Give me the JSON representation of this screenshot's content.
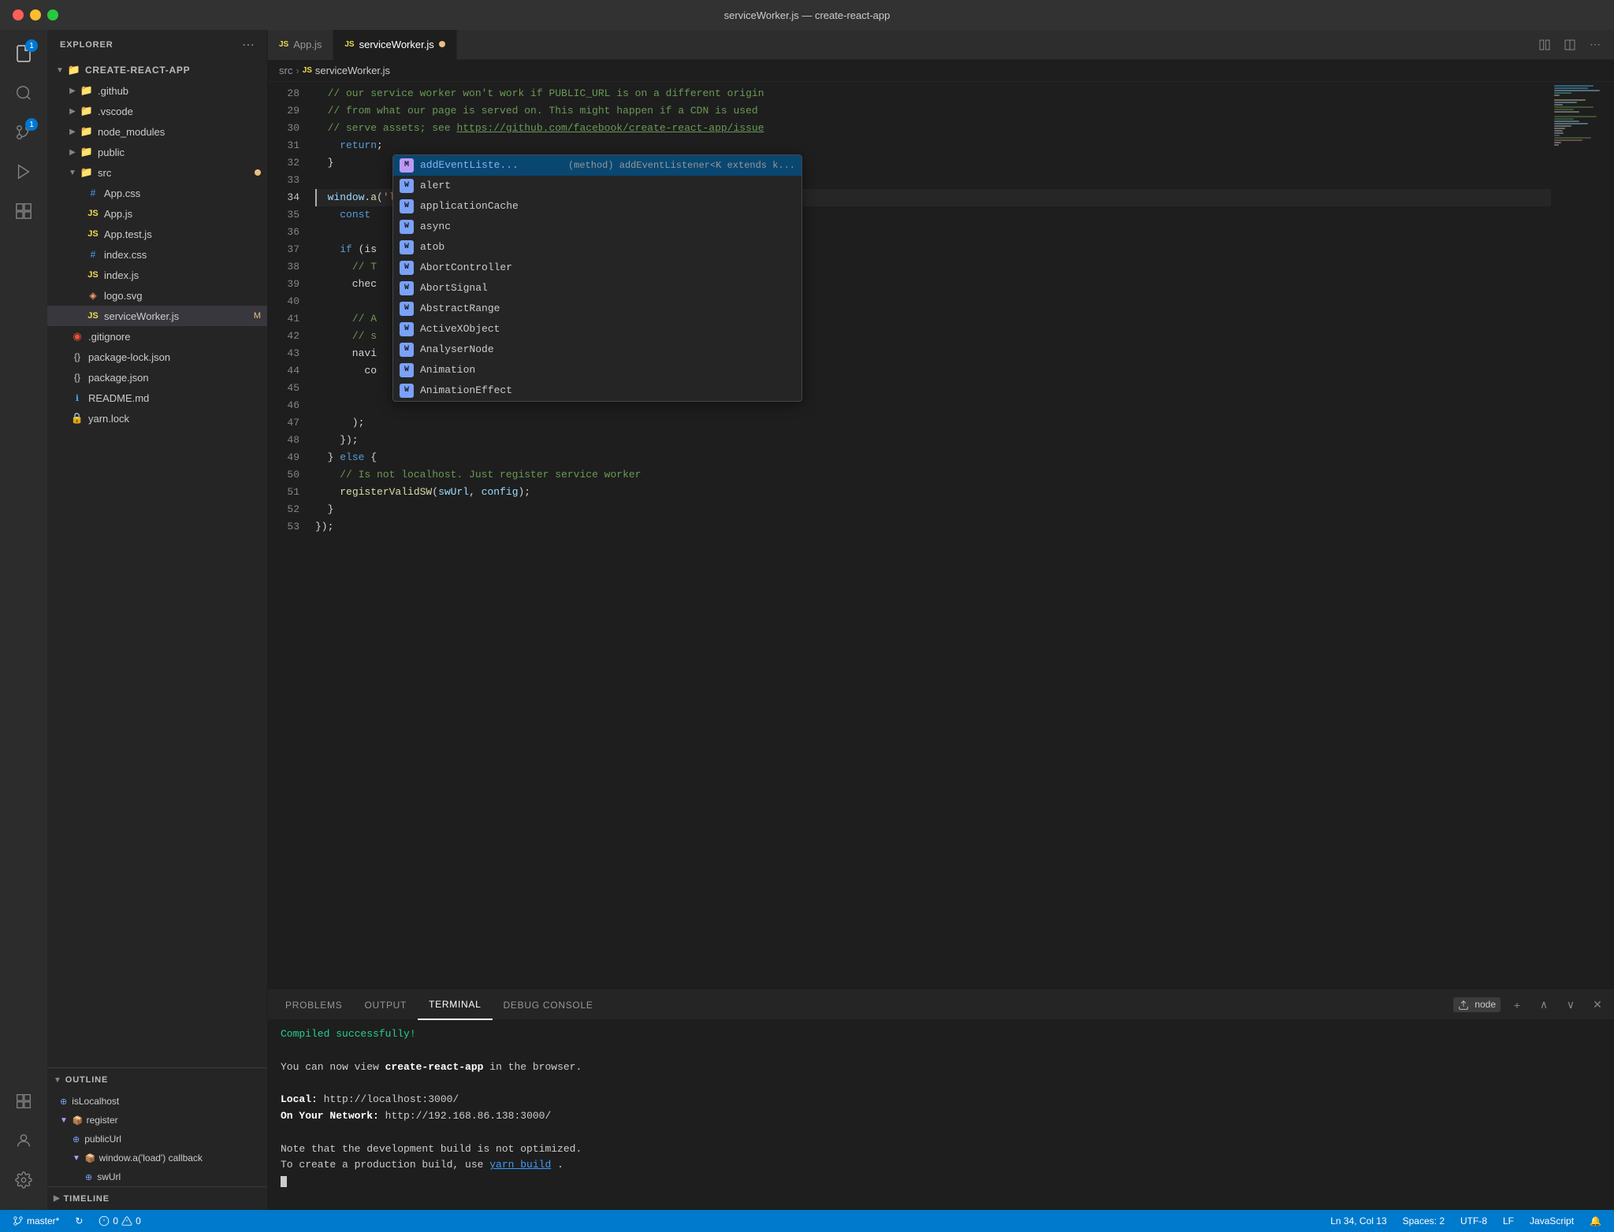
{
  "titlebar": {
    "title": "serviceWorker.js — create-react-app"
  },
  "activity_bar": {
    "icons": [
      {
        "name": "files-icon",
        "symbol": "⊞",
        "badge": "1",
        "active": false
      },
      {
        "name": "search-icon",
        "symbol": "🔍",
        "active": false
      },
      {
        "name": "source-control-icon",
        "symbol": "⑂",
        "badge": "1",
        "active": false
      },
      {
        "name": "run-debug-icon",
        "symbol": "▷",
        "active": false
      },
      {
        "name": "extensions-icon",
        "symbol": "⊡",
        "active": false
      }
    ],
    "bottom_icons": [
      {
        "name": "remote-icon",
        "symbol": "⊞",
        "active": false
      },
      {
        "name": "account-icon",
        "symbol": "👤",
        "active": false
      },
      {
        "name": "settings-icon",
        "symbol": "⚙",
        "active": false
      }
    ]
  },
  "sidebar": {
    "title": "EXPLORER",
    "project": "CREATE-REACT-APP",
    "tree": [
      {
        "id": "github",
        "label": ".github",
        "type": "folder",
        "depth": 1,
        "expanded": false
      },
      {
        "id": "vscode",
        "label": ".vscode",
        "type": "folder",
        "depth": 1,
        "expanded": false
      },
      {
        "id": "node_modules",
        "label": "node_modules",
        "type": "folder",
        "depth": 1,
        "expanded": false
      },
      {
        "id": "public",
        "label": "public",
        "type": "folder",
        "depth": 1,
        "expanded": false
      },
      {
        "id": "src",
        "label": "src",
        "type": "folder",
        "depth": 1,
        "expanded": true
      },
      {
        "id": "app_css",
        "label": "App.css",
        "type": "css",
        "depth": 2
      },
      {
        "id": "app_js",
        "label": "App.js",
        "type": "js",
        "depth": 2
      },
      {
        "id": "app_test_js",
        "label": "App.test.js",
        "type": "js",
        "depth": 2
      },
      {
        "id": "index_css",
        "label": "index.css",
        "type": "css",
        "depth": 2
      },
      {
        "id": "index_js",
        "label": "index.js",
        "type": "js",
        "depth": 2
      },
      {
        "id": "logo_svg",
        "label": "logo.svg",
        "type": "svg",
        "depth": 2
      },
      {
        "id": "serviceworker_js",
        "label": "serviceWorker.js",
        "type": "js",
        "depth": 2,
        "modified": true,
        "selected": true
      },
      {
        "id": "gitignore",
        "label": ".gitignore",
        "type": "git",
        "depth": 1
      },
      {
        "id": "package_lock",
        "label": "package-lock.json",
        "type": "json",
        "depth": 1
      },
      {
        "id": "package_json",
        "label": "package.json",
        "type": "json",
        "depth": 1
      },
      {
        "id": "readme",
        "label": "README.md",
        "type": "md",
        "depth": 1
      },
      {
        "id": "yarn_lock",
        "label": "yarn.lock",
        "type": "lock",
        "depth": 1
      }
    ]
  },
  "outline": {
    "title": "OUTLINE",
    "items": [
      {
        "label": "isLocalhost",
        "icon": "⊕",
        "depth": 0
      },
      {
        "label": "register",
        "icon": "📦",
        "depth": 0,
        "expanded": true
      },
      {
        "label": "publicUrl",
        "icon": "⊕",
        "depth": 1
      },
      {
        "label": "window.a('load') callback",
        "icon": "📦",
        "depth": 1,
        "expanded": true
      },
      {
        "label": "swUrl",
        "icon": "⊕",
        "depth": 2
      }
    ]
  },
  "timeline": {
    "title": "TIMELINE"
  },
  "tabs": [
    {
      "id": "app_js_tab",
      "label": "App.js",
      "type": "js",
      "active": false
    },
    {
      "id": "serviceworker_tab",
      "label": "serviceWorker.js",
      "type": "js",
      "active": true,
      "modified": true
    }
  ],
  "breadcrumb": {
    "parts": [
      "src",
      "JS",
      "serviceWorker.js"
    ]
  },
  "editor": {
    "lines": [
      {
        "num": 28,
        "code": "  // our service worker won't work if PUBLIC_URL is on a different origin"
      },
      {
        "num": 29,
        "code": "  // from what our page is served on. This might happen if a CDN is used"
      },
      {
        "num": 30,
        "code": "  // serve assets; see https://github.com/facebook/create-react-app/issue"
      },
      {
        "num": 31,
        "code": "    return;"
      },
      {
        "num": 32,
        "code": "  }"
      },
      {
        "num": 33,
        "code": ""
      },
      {
        "num": 34,
        "code": "  window.a('load', () => {",
        "active": true
      },
      {
        "num": 35,
        "code": "    const "
      },
      {
        "num": 36,
        "code": ""
      },
      {
        "num": 37,
        "code": "    if (is                                           stil"
      },
      {
        "num": 38,
        "code": "      // T"
      },
      {
        "num": 39,
        "code": "      chec"
      },
      {
        "num": 40,
        "code": ""
      },
      {
        "num": 41,
        "code": "      // A                                              to t"
      },
      {
        "num": 42,
        "code": "      // s"
      },
      {
        "num": 43,
        "code": "      navi"
      },
      {
        "num": 44,
        "code": "        co"
      },
      {
        "num": 45,
        "code": ""
      },
      {
        "num": 46,
        "code": ""
      },
      {
        "num": 47,
        "code": "      );"
      },
      {
        "num": 48,
        "code": "    });"
      },
      {
        "num": 49,
        "code": "  } else {"
      },
      {
        "num": 50,
        "code": "    // Is not localhost. Just register service worker"
      },
      {
        "num": 51,
        "code": "    registerValidSW(swUrl, config);"
      },
      {
        "num": 52,
        "code": "  }"
      },
      {
        "num": 53,
        "code": "});"
      }
    ],
    "cursor": {
      "line": 34,
      "col": 13
    }
  },
  "autocomplete": {
    "items": [
      {
        "label": "addEventListener",
        "detail": "(method) addEventListener<K extends k...",
        "icon_type": "method",
        "icon_letter": "M",
        "selected": true
      },
      {
        "label": "alert",
        "icon_type": "global",
        "icon_letter": "W"
      },
      {
        "label": "applicationCache",
        "icon_type": "global",
        "icon_letter": "W"
      },
      {
        "label": "async",
        "icon_type": "global",
        "icon_letter": "W"
      },
      {
        "label": "atob",
        "icon_type": "global",
        "icon_letter": "W"
      },
      {
        "label": "AbortController",
        "icon_type": "global",
        "icon_letter": "W"
      },
      {
        "label": "AbortSignal",
        "icon_type": "global",
        "icon_letter": "W"
      },
      {
        "label": "AbstractRange",
        "icon_type": "global",
        "icon_letter": "W"
      },
      {
        "label": "ActiveXObject",
        "icon_type": "global",
        "icon_letter": "W"
      },
      {
        "label": "AnalyserNode",
        "icon_type": "global",
        "icon_letter": "W"
      },
      {
        "label": "Animation",
        "icon_type": "global",
        "icon_letter": "W"
      },
      {
        "label": "AnimationEffect",
        "icon_type": "global",
        "icon_letter": "W"
      }
    ]
  },
  "panel": {
    "tabs": [
      {
        "id": "problems",
        "label": "PROBLEMS"
      },
      {
        "id": "output",
        "label": "OUTPUT"
      },
      {
        "id": "terminal",
        "label": "TERMINAL",
        "active": true
      },
      {
        "id": "debug_console",
        "label": "DEBUG CONSOLE"
      }
    ],
    "terminal_node_label": "node",
    "terminal_lines": [
      {
        "type": "success",
        "text": "Compiled successfully!"
      },
      {
        "type": "normal",
        "text": ""
      },
      {
        "type": "normal",
        "text": "You can now view "
      },
      {
        "type": "normal",
        "text": ""
      },
      {
        "type": "normal",
        "text": "  Local:            http://localhost:3000/"
      },
      {
        "type": "normal",
        "text": "  On Your Network:  http://192.168.86.138:3000/"
      },
      {
        "type": "normal",
        "text": ""
      },
      {
        "type": "normal",
        "text": "Note that the development build is not optimized."
      },
      {
        "type": "normal",
        "text": "To create a production build, use "
      }
    ],
    "terminal_app_name": "create-react-app",
    "terminal_yarn_build": "yarn build",
    "terminal_suffix": " in the browser.",
    "terminal_period": "."
  },
  "status_bar": {
    "branch": "master*",
    "sync_icon": "↻",
    "errors": "0",
    "warnings": "0",
    "ln": "Ln 34, Col 13",
    "spaces": "Spaces: 2",
    "encoding": "UTF-8",
    "eol": "LF",
    "language": "JavaScript",
    "bell_icon": "🔔"
  }
}
